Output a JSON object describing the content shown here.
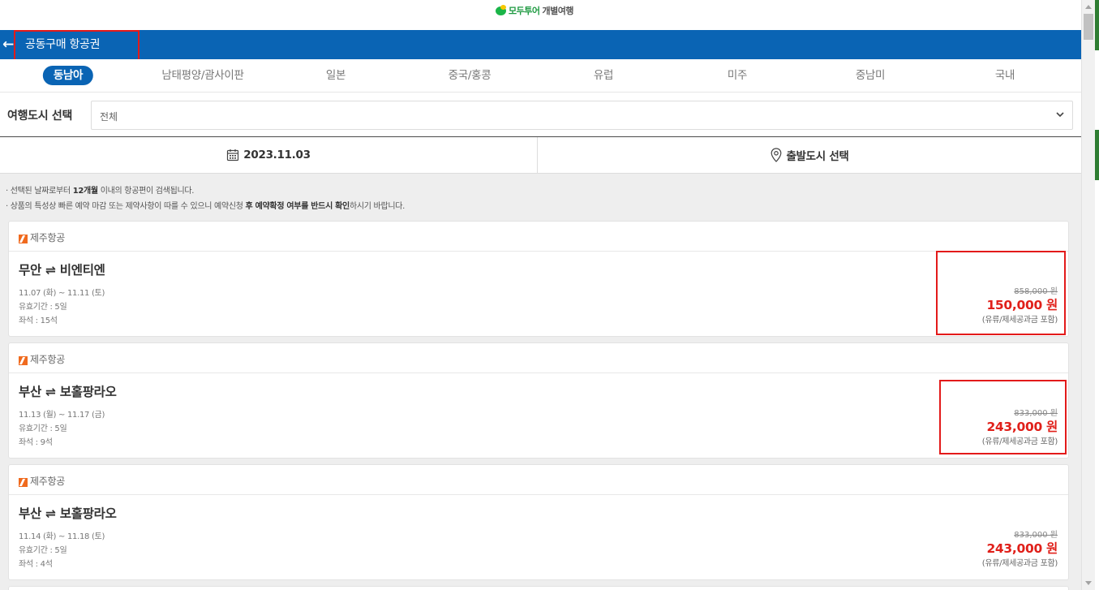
{
  "logo": {
    "brand": "모두투어",
    "sub": "개별여행"
  },
  "header": {
    "title": "공동구매 항공권"
  },
  "tabs": [
    "동남아",
    "남태평양/괌사이판",
    "일본",
    "중국/홍콩",
    "유럽",
    "미주",
    "중남미",
    "국내"
  ],
  "filter": {
    "label": "여행도시 선택",
    "value": "전체"
  },
  "datebar": {
    "date": "2023.11.03",
    "city": "출발도시 선택"
  },
  "notices": {
    "n1_pre": "· 선택된 날짜로부터 ",
    "n1_bold": "12개월",
    "n1_post": " 이내의 항공편이 검색됩니다.",
    "n2_pre": "· 상품의 특성상 빠른 예약 마감 또는 제약사항이 따를 수 있으니 예약신청 ",
    "n2_b1": "후 예약확정 여부를 반드시 확인",
    "n2_post": "하시기 바랍니다."
  },
  "cards": [
    {
      "airline": "제주항공",
      "route": "무안 ⇌ 비엔티엔",
      "dates": "11.07 (화) ~ 11.11 (토)",
      "validity": "유효기간 : 5일",
      "seats": "좌석 : 15석",
      "orig_price": "858,000 원",
      "price": "150,000 원",
      "note": "(유류/제세공과금 포함)"
    },
    {
      "airline": "제주항공",
      "route": "부산 ⇌ 보홀팡라오",
      "dates": "11.13 (월) ~ 11.17 (금)",
      "validity": "유효기간 : 5일",
      "seats": "좌석 : 9석",
      "orig_price": "833,000 원",
      "price": "243,000 원",
      "note": "(유류/제세공과금 포함)"
    },
    {
      "airline": "제주항공",
      "route": "부산 ⇌ 보홀팡라오",
      "dates": "11.14 (화) ~ 11.18 (토)",
      "validity": "유효기간 : 5일",
      "seats": "좌석 : 4석",
      "orig_price": "833,000 원",
      "price": "243,000 원",
      "note": "(유류/제세공과금 포함)"
    }
  ],
  "colors": {
    "primary": "#0a64b4",
    "price": "#e0201a",
    "highlight": "#e31a1a",
    "airline": "#f06a1e"
  }
}
